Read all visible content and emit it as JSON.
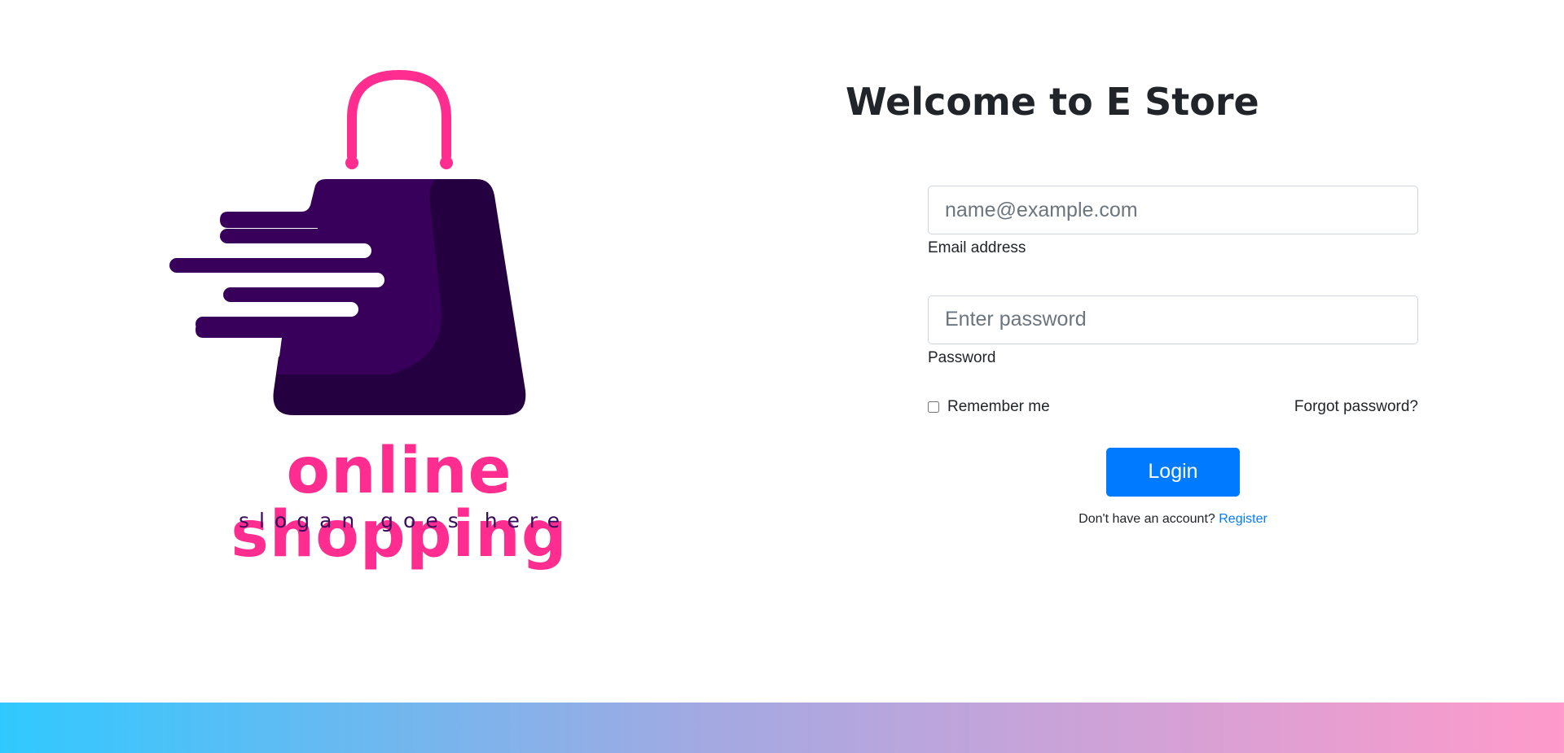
{
  "logo": {
    "brand_name": "online shopping",
    "slogan": "slogan goes here",
    "colors": {
      "pink": "#ff2d8f",
      "purple_light": "#38005a",
      "purple_dark": "#250040"
    }
  },
  "title": "Welcome to E Store",
  "form": {
    "email": {
      "placeholder": "name@example.com",
      "value": "",
      "label": "Email address"
    },
    "password": {
      "placeholder": "Enter password",
      "value": "",
      "label": "Password"
    },
    "remember_label": "Remember me",
    "remember_checked": false,
    "forgot_label": "Forgot password?",
    "login_label": "Login",
    "no_account_text": "Don't have an account?",
    "register_label": "Register"
  },
  "colors": {
    "primary": "#007bff",
    "footer_gradient": [
      "#30c9ff",
      "#a3a9e2",
      "#ff9acb"
    ]
  }
}
